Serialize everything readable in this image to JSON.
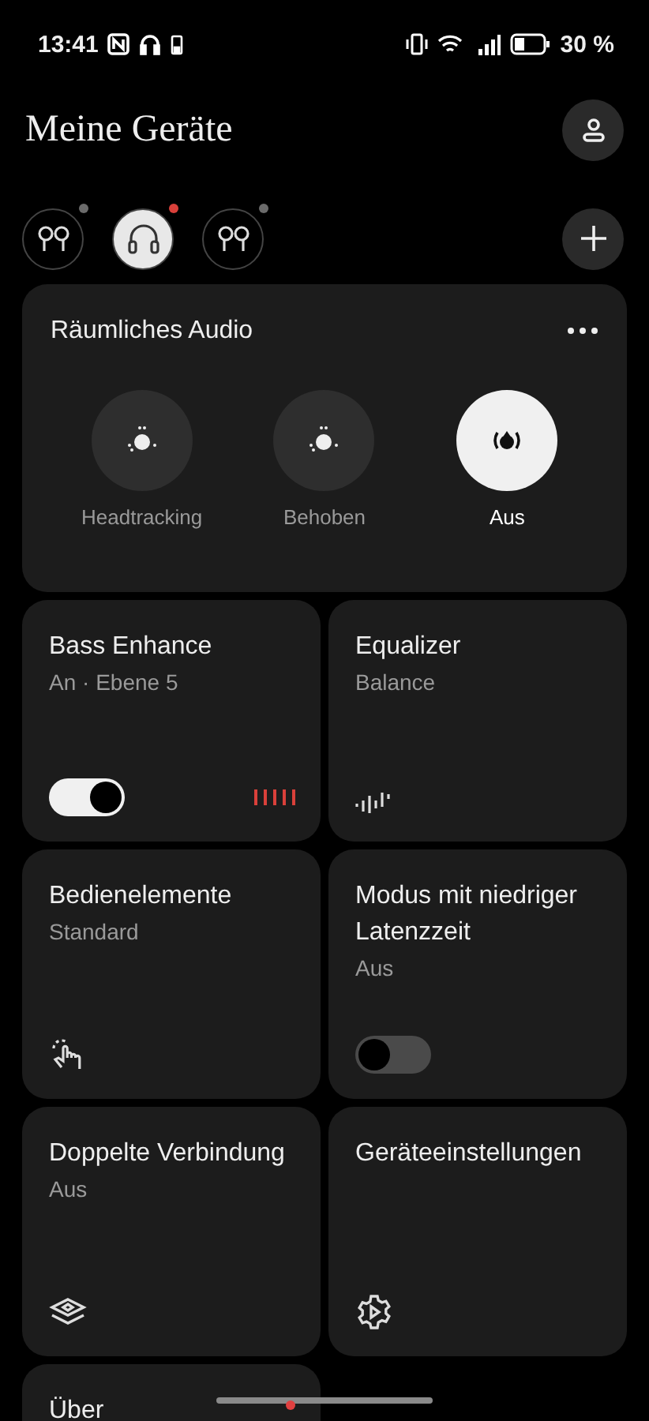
{
  "status_bar": {
    "time": "13:41",
    "battery": "30 %"
  },
  "header": {
    "title": "Meine Geräte"
  },
  "devices": [
    {
      "kind": "earbuds",
      "selected": false,
      "color": "#6b6b6b"
    },
    {
      "kind": "headphones",
      "selected": true,
      "color": "#d9403a"
    },
    {
      "kind": "earbuds",
      "selected": false,
      "color": "#6b6b6b"
    }
  ],
  "spatial_audio": {
    "title": "Räumliches Audio",
    "modes": [
      {
        "label": "Headtracking",
        "selected": false
      },
      {
        "label": "Behoben",
        "selected": false
      },
      {
        "label": "Aus",
        "selected": true
      }
    ]
  },
  "tiles": [
    {
      "kind": "toggle",
      "title": "Bass Enhance",
      "subtitle": "An · Ebene 5",
      "on": true
    },
    {
      "kind": "equalizer",
      "title": "Equalizer",
      "subtitle": "Balance"
    },
    {
      "kind": "gesture",
      "title": "Bedienelemente",
      "subtitle": "Standard"
    },
    {
      "kind": "toggle",
      "title": "Modus mit niedriger Latenzzeit",
      "subtitle": "Aus",
      "on": false
    },
    {
      "kind": "dual",
      "title": "Doppelte Verbindung",
      "subtitle": "Aus"
    },
    {
      "kind": "settings",
      "title": "Geräteeinstellungen"
    },
    {
      "kind": "plain",
      "title": "Über"
    }
  ]
}
